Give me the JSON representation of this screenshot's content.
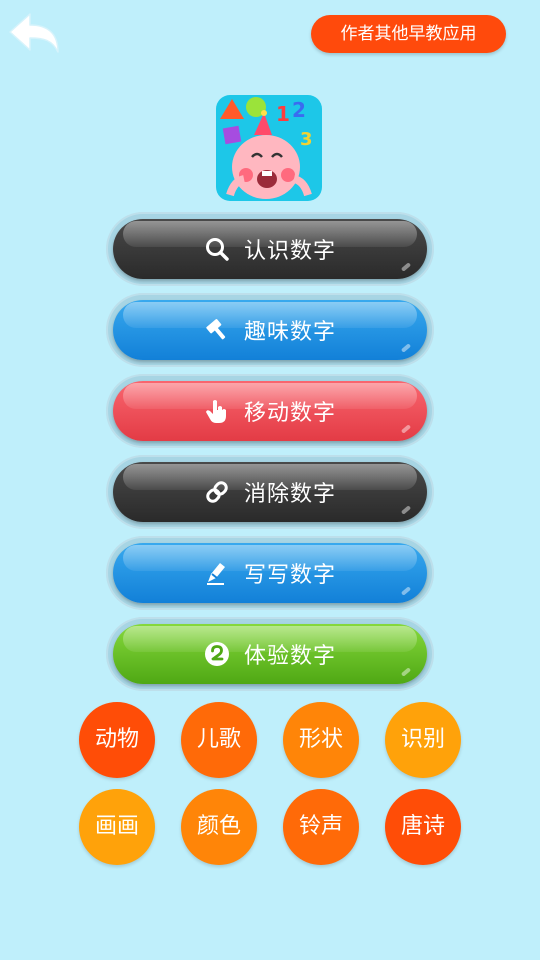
{
  "header": {
    "other_apps_label": "作者其他早教应用"
  },
  "icons": {
    "back": "back-arrow-icon",
    "app": "baby-numbers-app-icon"
  },
  "menu": [
    {
      "label": "认识数字",
      "color": "#333333",
      "icon": "search-icon"
    },
    {
      "label": "趣味数字",
      "color": "#1a8ee2",
      "icon": "hammer-icon"
    },
    {
      "label": "移动数字",
      "color": "#ee4f59",
      "icon": "hand-pointer-icon"
    },
    {
      "label": "消除数字",
      "color": "#333333",
      "icon": "link-icon"
    },
    {
      "label": "写写数字",
      "color": "#1a8ee2",
      "icon": "pen-icon"
    },
    {
      "label": "体验数字",
      "color": "#5cb51c",
      "icon": "number-two-icon"
    }
  ],
  "categories": [
    {
      "label": "动物",
      "color": "#ff4d07"
    },
    {
      "label": "儿歌",
      "color": "#ff6a08"
    },
    {
      "label": "形状",
      "color": "#ff8508"
    },
    {
      "label": "识别",
      "color": "#ffa20a"
    },
    {
      "label": "画画",
      "color": "#ffa20a"
    },
    {
      "label": "颜色",
      "color": "#ff8508"
    },
    {
      "label": "铃声",
      "color": "#ff6a08"
    },
    {
      "label": "唐诗",
      "color": "#ff4d07"
    }
  ]
}
